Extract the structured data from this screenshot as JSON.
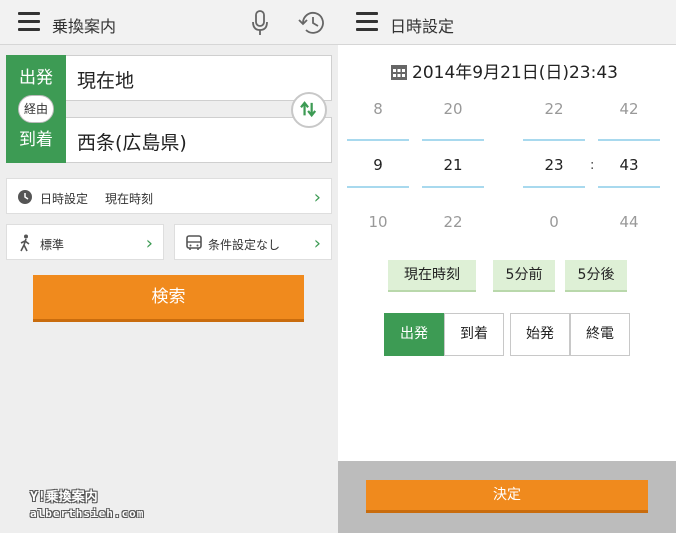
{
  "left": {
    "appbar": {
      "title": "乗換案内"
    },
    "route": {
      "from_tag": "出発",
      "from_value": "現在地",
      "via_label": "経由",
      "to_tag": "到着",
      "to_value": "西条(広島県)"
    },
    "datetime_card": {
      "label": "日時設定",
      "value": "現在時刻"
    },
    "walk_card": {
      "label": "標準"
    },
    "conditions_card": {
      "label": "条件設定なし"
    },
    "search_button": "検索",
    "watermark": {
      "line1": "Y!乗換案内",
      "line2": "alberthsieh.com"
    }
  },
  "right": {
    "appbar": {
      "title": "日時設定"
    },
    "date_display": "2014年9月21日(日)23:43",
    "picker": {
      "month": {
        "prev": "8",
        "current": "9",
        "next": "10"
      },
      "day": {
        "prev": "20",
        "current": "21",
        "next": "22"
      },
      "hour": {
        "prev": "22",
        "current": "23",
        "next": "0"
      },
      "minute": {
        "prev": "42",
        "current": "43",
        "next": "44"
      },
      "separator": ":"
    },
    "quick_buttons": {
      "now": "現在時刻",
      "minus5": "5分前",
      "plus5": "5分後"
    },
    "mode_buttons": {
      "depart": "出発",
      "arrive": "到着",
      "first": "始発",
      "last": "終電"
    },
    "confirm_button": "決定"
  },
  "colors": {
    "accent_green": "#3d9b54",
    "accent_orange": "#f08a1d",
    "picker_line": "#a8d9ee",
    "quick_button_bg": "#def0d6"
  },
  "icons": [
    "menu-icon",
    "microphone-icon",
    "history-icon",
    "swap-icon",
    "clock-icon",
    "walk-icon",
    "bus-icon",
    "calendar-icon",
    "chevron-right-icon"
  ]
}
